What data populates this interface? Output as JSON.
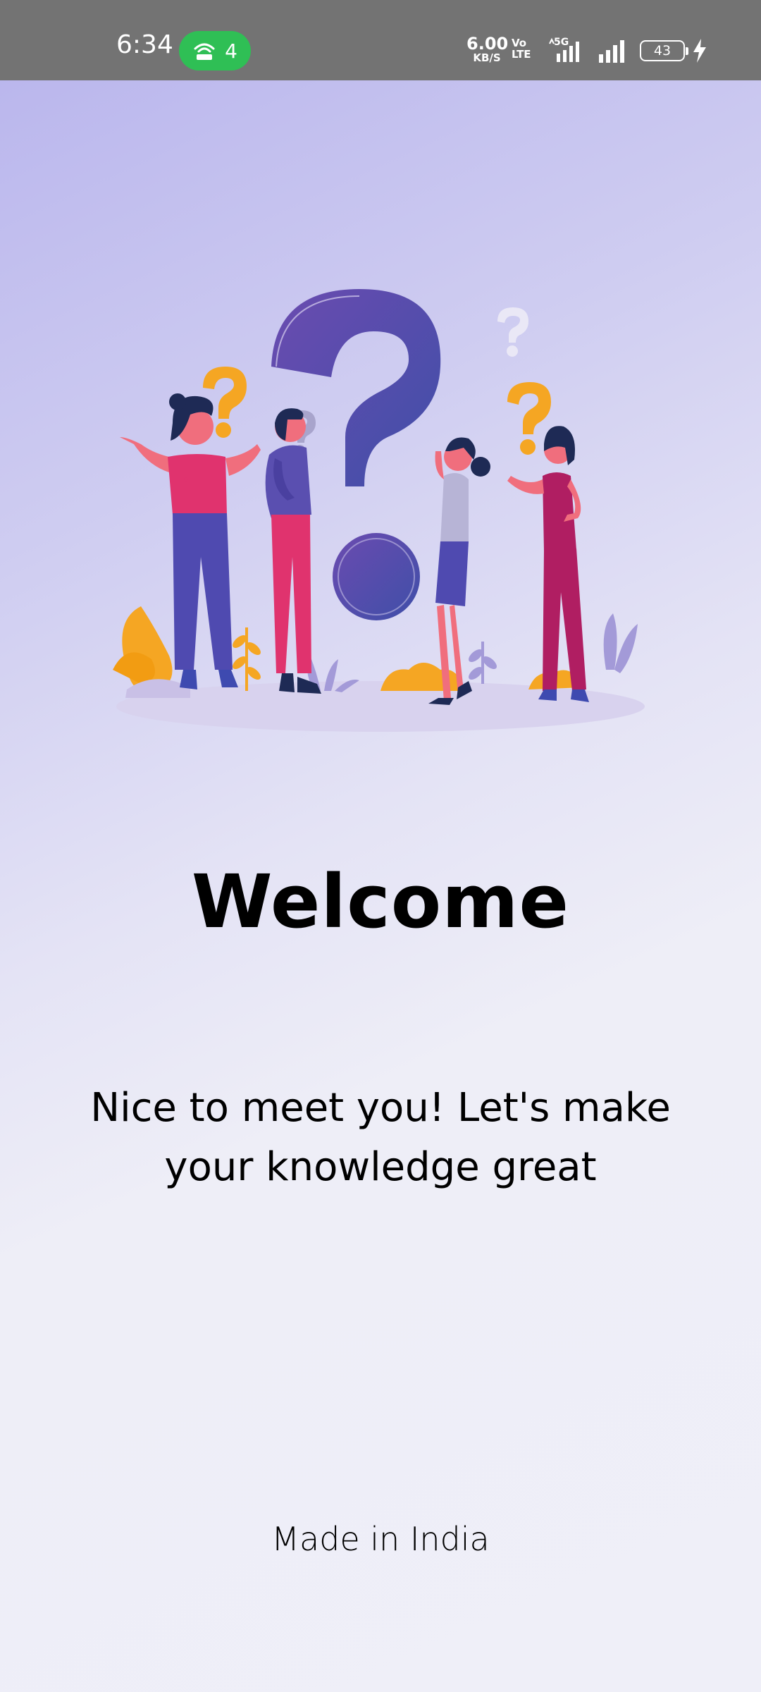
{
  "status_bar": {
    "time": "6:34",
    "hotspot_count": "4",
    "net_speed_value": "6.00",
    "net_speed_unit": "KB/S",
    "volte_line1": "Vo",
    "volte_line2": "LTE",
    "network_type": "5G",
    "battery_level": "43",
    "status_bar_color": "#737373",
    "hotspot_color": "#2fbf55"
  },
  "illustration": {
    "icon": "people-question-mark-illustration",
    "accent_purple": "#5b4aa8",
    "accent_orange": "#f5a623",
    "accent_pink": "#e8457a"
  },
  "main": {
    "title": "Welcome",
    "subtitle_line1": "Nice to meet you! Let's make",
    "subtitle_line2": "your knowledge great"
  },
  "footer": {
    "text": "Made in India"
  }
}
